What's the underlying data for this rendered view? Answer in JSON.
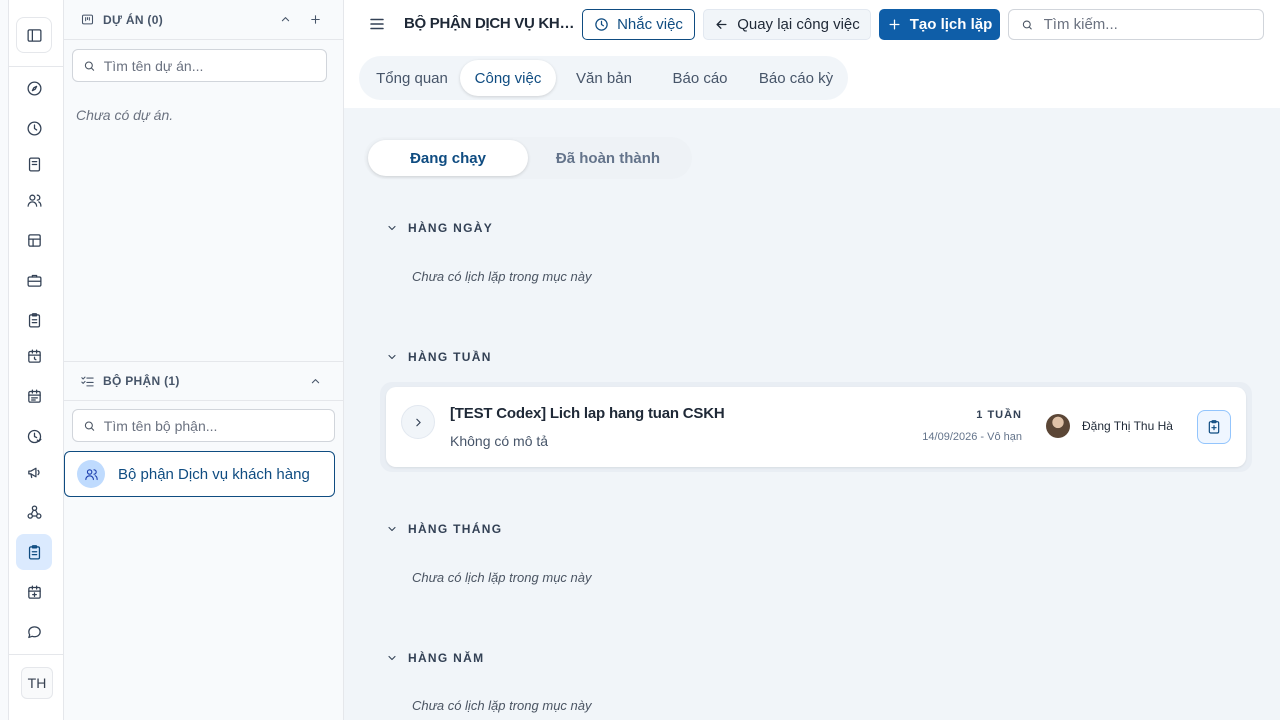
{
  "rail": {
    "items": [
      "toggle-sidebar",
      "compass",
      "clock",
      "book",
      "users",
      "layout",
      "briefcase",
      "clipboard",
      "calendar-clock",
      "calendar",
      "history",
      "megaphone",
      "network",
      "clipboard-active",
      "calendar-plus",
      "message"
    ],
    "user_initials": "TH"
  },
  "projects": {
    "title": "DỰ ÁN (0)",
    "search_placeholder": "Tìm tên dự án...",
    "empty_text": "Chưa có dự án."
  },
  "departments": {
    "title": "BỘ PHẬN (1)",
    "search_placeholder": "Tìm tên bộ phận...",
    "items": [
      {
        "label": "Bộ phận Dịch vụ khách hàng"
      }
    ]
  },
  "header": {
    "title": "BỘ PHẬN DỊCH VỤ KHÁCH HÀNG",
    "remind_label": "Nhắc việc",
    "back_label": "Quay lại công việc",
    "create_label": "Tạo lịch lặp",
    "search_placeholder": "Tìm kiếm..."
  },
  "tabs": [
    "Tổng quan",
    "Công việc",
    "Văn bản",
    "Báo cáo",
    "Báo cáo kỳ"
  ],
  "status_tabs": [
    "Đang chạy",
    "Đã hoàn thành"
  ],
  "groups": {
    "daily": {
      "title": "HÀNG NGÀY",
      "empty": "Chưa có lịch lặp trong mục này"
    },
    "weekly": {
      "title": "HÀNG TUẦN",
      "task": {
        "title": "[TEST Codex] Lich lap hang tuan CSKH",
        "description": "Không có mô tả",
        "frequency": "1 TUẦN",
        "dates": "14/09/2026 - Vô hạn",
        "assignee": "Đặng Thị Thu Hà"
      }
    },
    "monthly": {
      "title": "HÀNG THÁNG",
      "empty": "Chưa có lịch lặp trong mục này"
    },
    "yearly": {
      "title": "HÀNG NĂM",
      "empty": "Chưa có lịch lặp trong mục này"
    }
  },
  "colors": {
    "accent": "#0f4c81",
    "primary_button": "#0f5ea8",
    "active_bg": "#dbeafe"
  }
}
